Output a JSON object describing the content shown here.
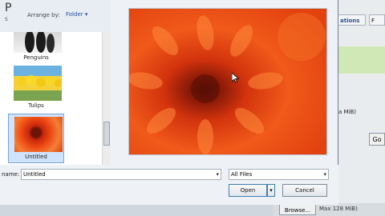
{
  "background_app": {
    "tab_label": "ations",
    "tab2_label": "F",
    "size_text_top": "a MiB)",
    "go_label": "Go",
    "browse_label": "Browse...",
    "size_text_bottom": "Max 128 MiB)"
  },
  "dialog": {
    "library_title": "P",
    "library_subtitle": "S",
    "arrange_label": "Arrange by:",
    "arrange_value": "Folder",
    "arrange_icon": "chevron-down-icon",
    "thumbnails": [
      {
        "label": "Penguins"
      },
      {
        "label": "Tulips"
      },
      {
        "label": "Untitled",
        "selected": true
      }
    ],
    "filename_label": "name:",
    "filename_value": "Untitled",
    "filetype_value": "All Files",
    "open_label": "Open",
    "cancel_label": "Cancel"
  },
  "colors": {
    "accent": "#3c7fb1",
    "selection": "#cfe3fc",
    "flower_orange": "#ee4a15"
  }
}
